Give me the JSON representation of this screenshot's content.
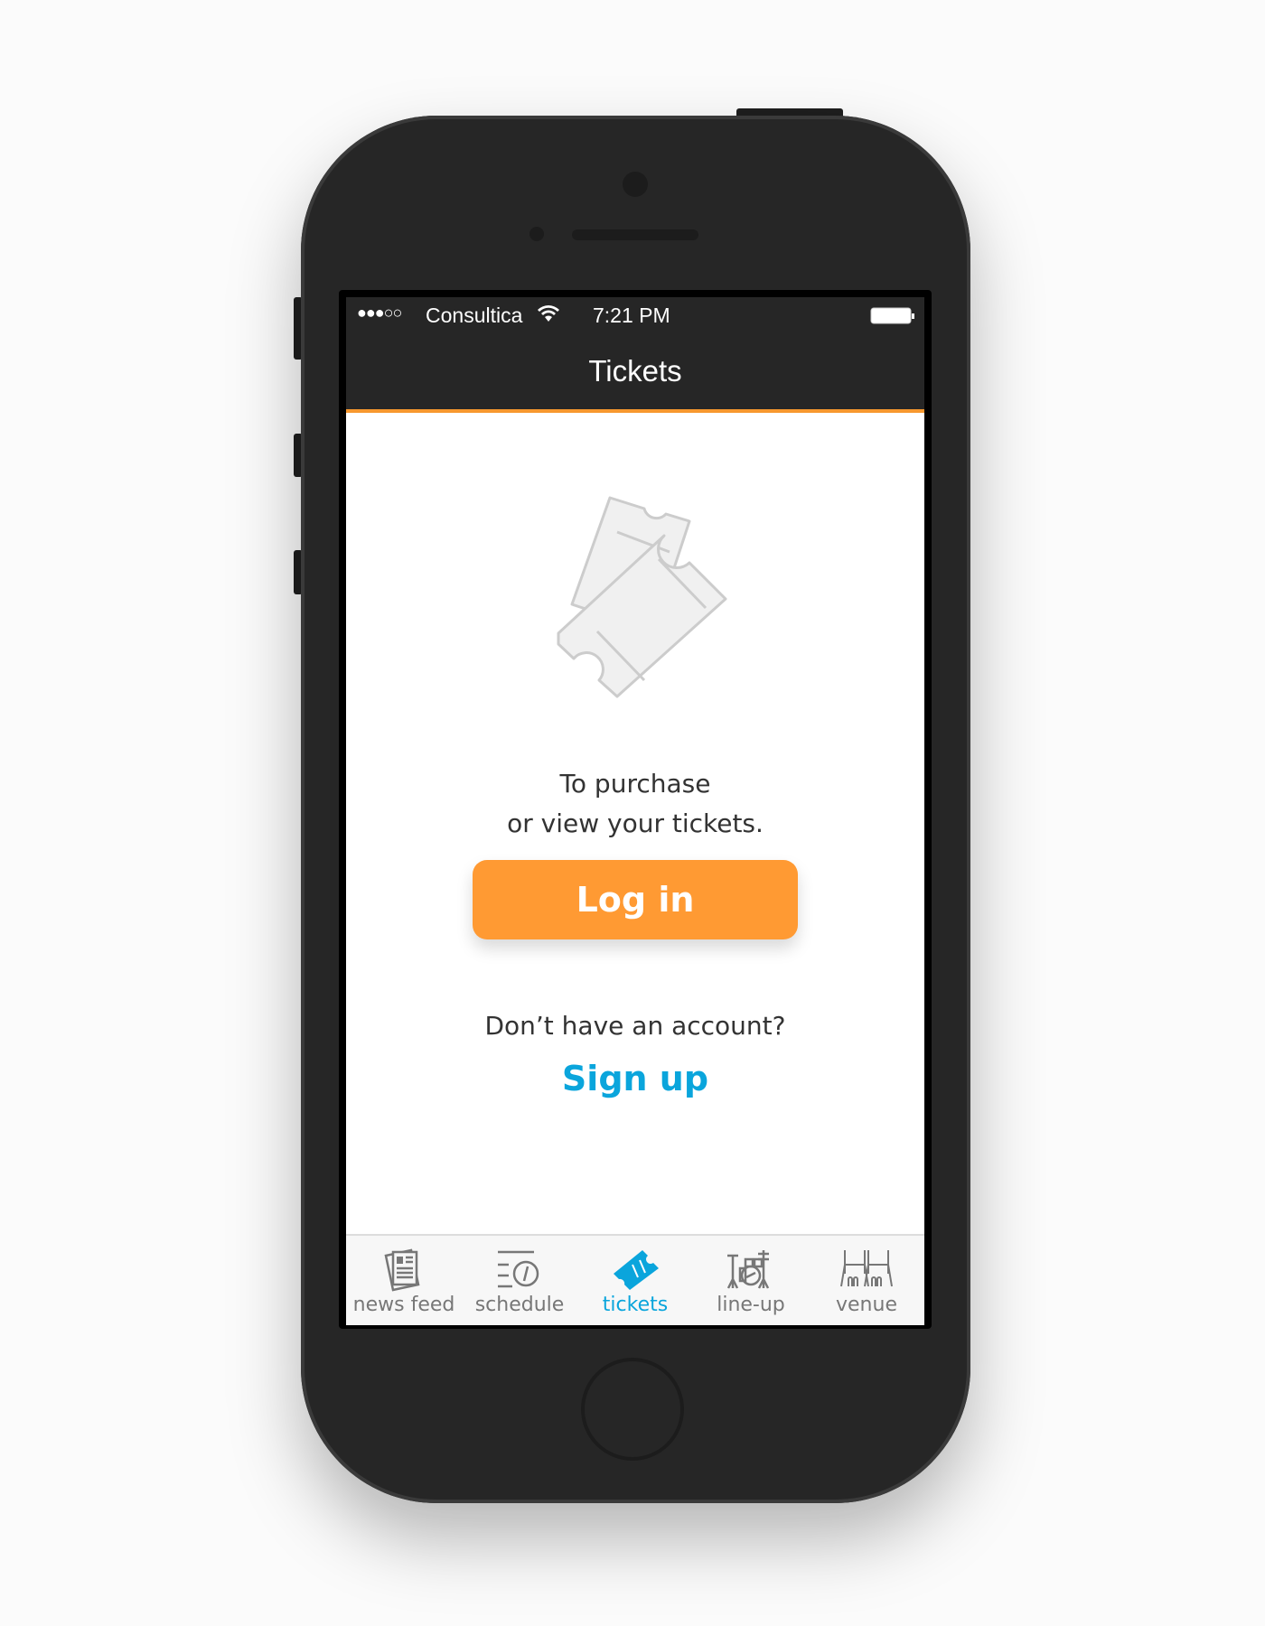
{
  "status_bar": {
    "signal": "●●●○○",
    "carrier": "Consultica",
    "time": "7:21 PM"
  },
  "nav": {
    "title": "Tickets"
  },
  "main": {
    "line1": "To purchase",
    "line2": "or view your tickets.",
    "login_label": "Log in",
    "no_account": "Don’t have an account?",
    "signup_label": "Sign up"
  },
  "tabs": [
    {
      "label": "news feed",
      "icon": "newspaper-icon"
    },
    {
      "label": "schedule",
      "icon": "clock-icon"
    },
    {
      "label": "tickets",
      "icon": "ticket-icon",
      "active": true
    },
    {
      "label": "line-up",
      "icon": "drums-icon"
    },
    {
      "label": "venue",
      "icon": "venue-icon"
    }
  ],
  "colors": {
    "accent": "#ff9a33",
    "link": "#0aa5dc",
    "dark": "#262626"
  }
}
